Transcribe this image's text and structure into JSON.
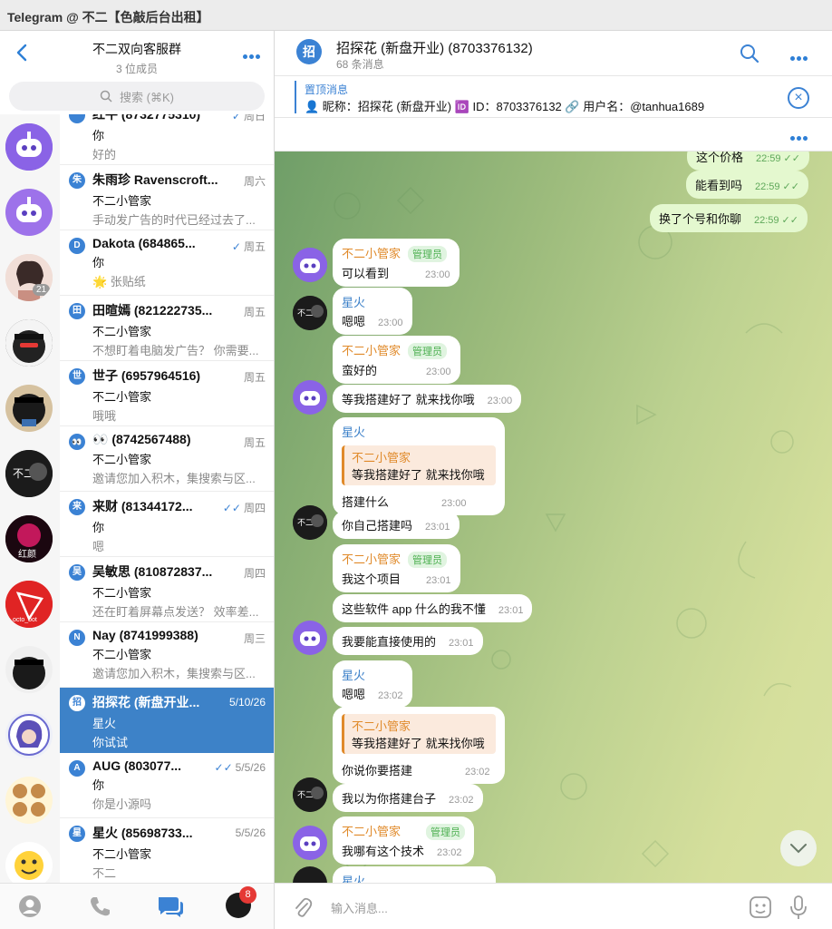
{
  "window": {
    "title": "Telegram @ 不二【色敲后台出租】"
  },
  "left": {
    "header": {
      "title": "不二双向客服群",
      "subtitle": "3 位成员"
    },
    "search": {
      "placeholder": "搜索 (⌘K)"
    },
    "chats": [
      {
        "badge": "",
        "name": "红牛 (8732775310)",
        "date": "周日",
        "sender": "你",
        "preview": "好的",
        "tick": "✓"
      },
      {
        "badge": "朱",
        "name": "朱雨珍 Ravenscroft...",
        "date": "周六",
        "sender": "不二小管家",
        "preview": "手动发广告的时代已经过去了...",
        "tick": ""
      },
      {
        "badge": "D",
        "name": "Dakota (684865...",
        "date": "周五",
        "sender": "你",
        "preview": "🌟 张贴纸",
        "tick": "✓"
      },
      {
        "badge": "田",
        "name": "田暄嫣 (821222735...",
        "date": "周五",
        "sender": "不二小管家",
        "preview": "不想盯着电脑发广告？ 你需要...",
        "tick": ""
      },
      {
        "badge": "世",
        "name": "世子 (6957964516)",
        "date": "周五",
        "sender": "不二小管家",
        "preview": "哦哦",
        "tick": ""
      },
      {
        "badge": "👀",
        "name": "👀 (8742567488)",
        "date": "周五",
        "sender": "不二小管家",
        "preview": "邀请您加入积木，集搜索与区...",
        "tick": ""
      },
      {
        "badge": "来",
        "name": "来财 (81344172...",
        "date": "周四",
        "sender": "你",
        "preview": "嗯",
        "tick": "✓✓"
      },
      {
        "badge": "吴",
        "name": "吴敏思 (810872837...",
        "date": "周四",
        "sender": "不二小管家",
        "preview": "还在盯着屏幕点发送？ 效率差...",
        "tick": ""
      },
      {
        "badge": "N",
        "name": "Nay (8741999388)",
        "date": "周三",
        "sender": "不二小管家",
        "preview": "邀请您加入积木，集搜索与区...",
        "tick": ""
      },
      {
        "badge": "招",
        "name": "招探花 (新盘开业...",
        "date": "5/10/26",
        "sender": "星火",
        "preview": "你试试",
        "tick": ""
      },
      {
        "badge": "A",
        "name": "AUG (803077...",
        "date": "5/5/26",
        "sender": "你",
        "preview": "你是小源吗",
        "tick": "✓✓"
      },
      {
        "badge": "星",
        "name": "星火 (85698733...",
        "date": "5/5/26",
        "sender": "不二小管家",
        "preview": "不二",
        "tick": ""
      }
    ],
    "rail_badge_count": "21",
    "footer_badge": "8",
    "avatar_texts": {
      "red_glow": "红颜",
      "tron": "octo_bot"
    }
  },
  "right": {
    "header": {
      "avatar_letter": "招",
      "title": "招探花 (新盘开业) (8703376132)",
      "subtitle": "68 条消息"
    },
    "pinned": {
      "title": "置顶消息",
      "content": "👤 昵称：招探花 (新盘开业) 🆔 ID：8703376132 🔗 用户名：@tanhua1689"
    },
    "messages": {
      "m0": {
        "text": "这个价格",
        "time": "22:59"
      },
      "m1": {
        "text": "能看到吗",
        "time": "22:59"
      },
      "m2": {
        "text": "换了个号和你聊",
        "time": "22:59"
      },
      "m3": {
        "name": "不二小管家",
        "tag": "管理员",
        "text": "可以看到",
        "time": "23:00"
      },
      "m4": {
        "name": "星火",
        "text": "嗯嗯",
        "time": "23:00"
      },
      "m5": {
        "name": "不二小管家",
        "tag": "管理员",
        "text": "蛮好的",
        "time": "23:00"
      },
      "m6": {
        "text": "等我搭建好了  就来找你哦",
        "time": "23:00"
      },
      "m7": {
        "name": "星火",
        "q_name": "不二小管家",
        "q_text": "等我搭建好了  就来找你哦",
        "text": "搭建什么",
        "time": "23:00"
      },
      "m8": {
        "text": "你自己搭建吗",
        "time": "23:01"
      },
      "m9": {
        "name": "不二小管家",
        "tag": "管理员",
        "text": "我这个项目",
        "time": "23:01"
      },
      "m10": {
        "text": "这些软件 app 什么的我不懂",
        "time": "23:01"
      },
      "m11": {
        "text": "我要能直接使用的",
        "time": "23:01"
      },
      "m12": {
        "name": "星火",
        "text": "嗯嗯",
        "time": "23:02"
      },
      "m13": {
        "q_name": "不二小管家",
        "q_text": "等我搭建好了  就来找你哦",
        "text": "你说你要搭建",
        "time": "23:02"
      },
      "m14": {
        "text": "我以为你搭建台子",
        "time": "23:02"
      },
      "m15": {
        "name": "不二小管家",
        "tag": "管理员",
        "text": "我哪有这个技术",
        "time": "23:02"
      },
      "m16": {
        "name": "星火"
      }
    },
    "input": {
      "placeholder": "输入消息..."
    }
  },
  "colors": {
    "accent": "#3b82d4",
    "selected": "#3d82c8",
    "admin_name": "#e08a2a",
    "out_bubble": "#e4f8cf"
  }
}
